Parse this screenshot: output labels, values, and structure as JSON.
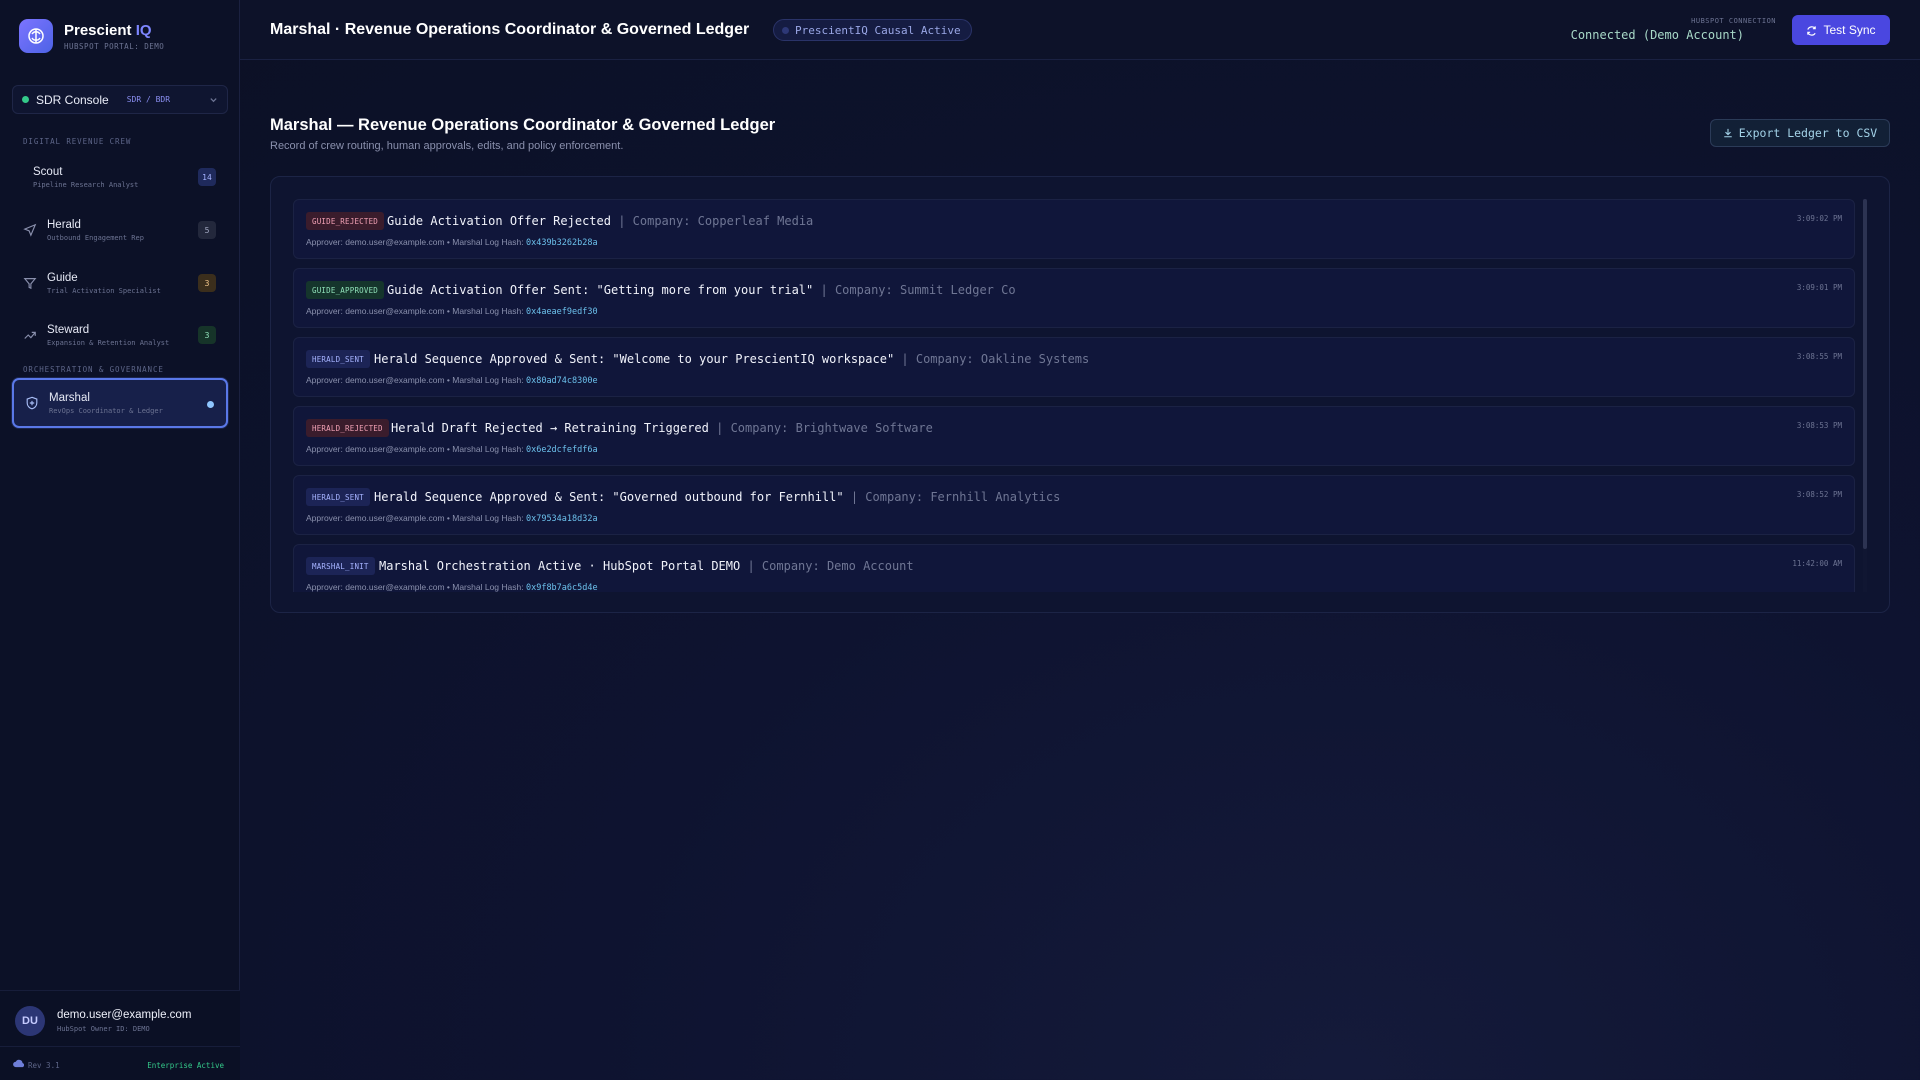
{
  "brand": {
    "name_main": "Prescient",
    "name_accent": "IQ",
    "subtitle": "HUBSPOT PORTAL: DEMO"
  },
  "console": {
    "label": "SDR Console",
    "tag": "SDR / BDR"
  },
  "sections": {
    "crew": "DIGITAL REVENUE CREW",
    "orchestration": "ORCHESTRATION & GOVERNANCE"
  },
  "nav": [
    {
      "title": "Scout",
      "subtitle": "Pipeline Research Analyst",
      "badge": "14",
      "icon": "search-icon"
    },
    {
      "title": "Herald",
      "subtitle": "Outbound Engagement Rep",
      "badge": "5",
      "icon": "send-icon"
    },
    {
      "title": "Guide",
      "subtitle": "Trial Activation Specialist",
      "badge": "3",
      "icon": "funnel-icon"
    },
    {
      "title": "Steward",
      "subtitle": "Expansion & Retention Analyst",
      "badge": "3",
      "icon": "trend-up-icon"
    },
    {
      "title": "Marshal",
      "subtitle": "RevOps Coordinator & Ledger",
      "icon": "shield-icon"
    }
  ],
  "user": {
    "initials": "DU",
    "email": "demo.user@example.com",
    "owner": "HubSpot Owner ID: DEMO",
    "rev": "Rev 3.1",
    "plan": "Enterprise Active"
  },
  "header": {
    "title": "Marshal · Revenue Operations Coordinator & Governed Ledger",
    "status_pill": "PrescientIQ Causal Active",
    "connection_label": "HUBSPOT CONNECTION",
    "connection_value": "Connected (Demo Account)",
    "sync_button": "Test Sync"
  },
  "main": {
    "title": "Marshal — Revenue Operations Coordinator & Governed Ledger",
    "subtitle": "Record of crew routing, human approvals, edits, and policy enforcement.",
    "export_button": "Export Ledger to CSV"
  },
  "ledger": [
    {
      "tag": "GUIDE_REJECTED",
      "tag_kind": "rej",
      "headline": "Guide Activation Offer Rejected",
      "company": "| Company: Copperleaf Media",
      "approver": "Approver: demo.user@example.com • Marshal Log Hash:",
      "hash": "0x439b3262b28a",
      "time": "3:09:02 PM"
    },
    {
      "tag": "GUIDE_APPROVED",
      "tag_kind": "app",
      "headline": "Guide Activation Offer Sent: \"Getting more from your trial\"",
      "company": "| Company: Summit Ledger Co",
      "approver": "Approver: demo.user@example.com • Marshal Log Hash:",
      "hash": "0x4aeaef9edf30",
      "time": "3:09:01 PM"
    },
    {
      "tag": "HERALD_SENT",
      "tag_kind": "sent",
      "headline": "Herald Sequence Approved & Sent: \"Welcome to your PrescientIQ workspace\"",
      "company": "| Company: Oakline Systems",
      "approver": "Approver: demo.user@example.com • Marshal Log Hash:",
      "hash": "0x80ad74c8300e",
      "time": "3:08:55 PM"
    },
    {
      "tag": "HERALD_REJECTED",
      "tag_kind": "rej",
      "headline": "Herald Draft Rejected → Retraining Triggered",
      "company": "| Company: Brightwave Software",
      "approver": "Approver: demo.user@example.com • Marshal Log Hash:",
      "hash": "0x6e2dcfefdf6a",
      "time": "3:08:53 PM"
    },
    {
      "tag": "HERALD_SENT",
      "tag_kind": "sent",
      "headline": "Herald Sequence Approved & Sent: \"Governed outbound for Fernhill\"",
      "company": "| Company: Fernhill Analytics",
      "approver": "Approver: demo.user@example.com • Marshal Log Hash:",
      "hash": "0x79534a18d32a",
      "time": "3:08:52 PM"
    },
    {
      "tag": "MARSHAL_INIT",
      "tag_kind": "init",
      "headline": "Marshal Orchestration Active · HubSpot Portal DEMO",
      "company": "| Company: Demo Account",
      "approver": "Approver: demo.user@example.com • Marshal Log Hash:",
      "hash": "0x9f8b7a6c5d4e",
      "time": "11:42:00 AM"
    }
  ],
  "colors": {
    "accent": "#4a47e0",
    "success": "#34c98a",
    "hash": "#6cc1ec"
  }
}
